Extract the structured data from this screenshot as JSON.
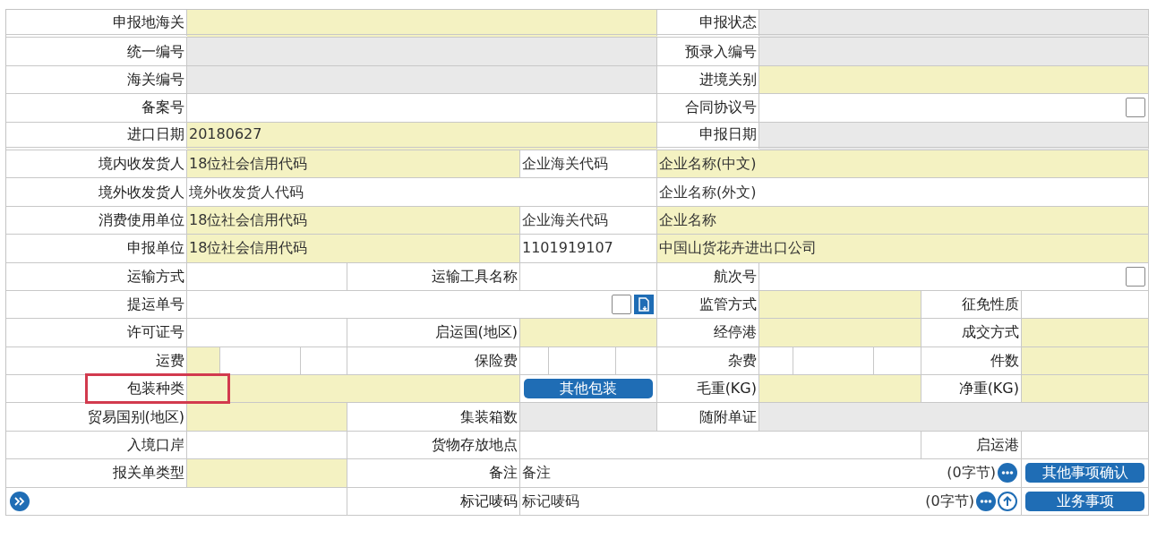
{
  "form": {
    "rows": [
      {
        "cells": [
          {
            "kind": "label",
            "text": "申报地海关"
          },
          {
            "kind": "field",
            "required": true,
            "readonly": false
          },
          {
            "kind": "label",
            "text": "申报状态"
          },
          {
            "kind": "field",
            "readonly": true
          }
        ]
      },
      {
        "cells": [
          {
            "kind": "label",
            "text": "统一编号"
          },
          {
            "kind": "field",
            "readonly": true
          },
          {
            "kind": "label",
            "text": "预录入编号"
          },
          {
            "kind": "field",
            "readonly": true
          }
        ]
      },
      {
        "cells": [
          {
            "kind": "label",
            "text": "海关编号"
          },
          {
            "kind": "field",
            "readonly": true
          },
          {
            "kind": "label",
            "text": "进境关别"
          },
          {
            "kind": "field",
            "required": true,
            "readonly": false
          }
        ]
      },
      {
        "cells": [
          {
            "kind": "label",
            "text": "备案号"
          },
          {
            "kind": "field",
            "required": false,
            "readonly": false
          },
          {
            "kind": "label",
            "text": "合同协议号"
          },
          {
            "kind": "field",
            "required": false,
            "readonly": false,
            "checkbox": {
              "checked": false
            }
          }
        ]
      },
      {
        "cells": [
          {
            "kind": "label",
            "text": "进口日期"
          },
          {
            "kind": "field",
            "required": true,
            "readonly": false,
            "value": "20180627"
          },
          {
            "kind": "label",
            "text": "申报日期"
          },
          {
            "kind": "field",
            "readonly": true
          }
        ]
      },
      {
        "cells": [
          {
            "kind": "label",
            "text": "境内收发货人"
          },
          {
            "kind": "field",
            "required": true,
            "readonly": false,
            "value": "18位社会信用代码"
          },
          {
            "kind": "field",
            "required": false,
            "readonly": false,
            "value": "企业海关代码"
          },
          {
            "kind": "field",
            "required": true,
            "readonly": false,
            "value": "企业名称(中文)"
          }
        ]
      },
      {
        "cells": [
          {
            "kind": "label",
            "text": "境外收发货人"
          },
          {
            "kind": "field",
            "required": false,
            "readonly": false,
            "value": "境外收发货人代码"
          },
          {
            "kind": "field",
            "required": false,
            "readonly": false,
            "value": "企业名称(外文)"
          }
        ]
      },
      {
        "cells": [
          {
            "kind": "label",
            "text": "消费使用单位"
          },
          {
            "kind": "field",
            "required": true,
            "readonly": false,
            "value": "18位社会信用代码"
          },
          {
            "kind": "field",
            "required": false,
            "readonly": false,
            "value": "企业海关代码"
          },
          {
            "kind": "field",
            "required": true,
            "readonly": false,
            "value": "企业名称"
          }
        ]
      },
      {
        "cells": [
          {
            "kind": "label",
            "text": "申报单位"
          },
          {
            "kind": "field",
            "required": true,
            "readonly": false,
            "value": "18位社会信用代码"
          },
          {
            "kind": "field",
            "required": false,
            "readonly": false,
            "value": "1101919107"
          },
          {
            "kind": "field",
            "required": true,
            "readonly": false,
            "value": "中国山货花卉进出口公司"
          }
        ]
      },
      {
        "cells": [
          {
            "kind": "label",
            "text": "运输方式"
          },
          {
            "kind": "field",
            "required": false,
            "readonly": false
          },
          {
            "kind": "label",
            "text": "运输工具名称"
          },
          {
            "kind": "field",
            "required": false,
            "readonly": false
          },
          {
            "kind": "label",
            "text": "航次号"
          },
          {
            "kind": "field",
            "required": false,
            "readonly": false,
            "checkbox": {
              "checked": false
            }
          }
        ]
      },
      {
        "cells": [
          {
            "kind": "label",
            "text": "提运单号"
          },
          {
            "kind": "field",
            "required": false,
            "readonly": false,
            "checkbox": {
              "checked": false
            },
            "lookup": true
          },
          {
            "kind": "label",
            "text": "监管方式"
          },
          {
            "kind": "field",
            "required": true,
            "readonly": false
          },
          {
            "kind": "label",
            "text": "征免性质"
          },
          {
            "kind": "field",
            "required": false,
            "readonly": false
          }
        ]
      },
      {
        "cells": [
          {
            "kind": "label",
            "text": "许可证号"
          },
          {
            "kind": "field",
            "required": false,
            "readonly": false
          },
          {
            "kind": "label",
            "text": "启运国(地区)"
          },
          {
            "kind": "field",
            "required": true,
            "readonly": false
          },
          {
            "kind": "label",
            "text": "经停港"
          },
          {
            "kind": "field",
            "required": true,
            "readonly": false
          },
          {
            "kind": "label",
            "text": "成交方式"
          },
          {
            "kind": "field",
            "required": true,
            "readonly": false
          }
        ]
      },
      {
        "cells": [
          {
            "kind": "label",
            "text": "运费"
          },
          {
            "kind": "field",
            "required": true,
            "readonly": false
          },
          {
            "kind": "field",
            "required": false,
            "readonly": false
          },
          {
            "kind": "field",
            "required": false,
            "readonly": false
          },
          {
            "kind": "label",
            "text": "保险费"
          },
          {
            "kind": "field",
            "required": false,
            "readonly": false
          },
          {
            "kind": "field",
            "required": false,
            "readonly": false
          },
          {
            "kind": "field",
            "required": false,
            "readonly": false
          },
          {
            "kind": "label",
            "text": "杂费"
          },
          {
            "kind": "field",
            "required": false,
            "readonly": false
          },
          {
            "kind": "field",
            "required": false,
            "readonly": false
          },
          {
            "kind": "field",
            "required": false,
            "readonly": false
          },
          {
            "kind": "label",
            "text": "件数"
          },
          {
            "kind": "field",
            "required": true,
            "readonly": false
          }
        ]
      },
      {
        "cells": [
          {
            "kind": "label",
            "text": "包装种类",
            "highlighted": true
          },
          {
            "kind": "field",
            "required": true,
            "readonly": false
          },
          {
            "kind": "button",
            "text": "其他包装"
          },
          {
            "kind": "label",
            "text": "毛重(KG)"
          },
          {
            "kind": "field",
            "required": true,
            "readonly": false
          },
          {
            "kind": "label",
            "text": "净重(KG)"
          },
          {
            "kind": "field",
            "required": true,
            "readonly": false
          }
        ]
      },
      {
        "cells": [
          {
            "kind": "label",
            "text": "贸易国别(地区)"
          },
          {
            "kind": "field",
            "required": true,
            "readonly": false
          },
          {
            "kind": "label",
            "text": "集装箱数"
          },
          {
            "kind": "field",
            "readonly": true
          },
          {
            "kind": "label",
            "text": "随附单证"
          },
          {
            "kind": "field",
            "readonly": true
          }
        ]
      },
      {
        "cells": [
          {
            "kind": "label",
            "text": "入境口岸"
          },
          {
            "kind": "field",
            "required": false,
            "readonly": false
          },
          {
            "kind": "label",
            "text": "货物存放地点"
          },
          {
            "kind": "field",
            "required": false,
            "readonly": false
          },
          {
            "kind": "label",
            "text": "启运港"
          },
          {
            "kind": "field",
            "required": false,
            "readonly": false
          }
        ]
      },
      {
        "cells": [
          {
            "kind": "label",
            "text": "报关单类型"
          },
          {
            "kind": "field",
            "required": true,
            "readonly": false
          },
          {
            "kind": "label",
            "text": "备注"
          },
          {
            "kind": "memo",
            "value": "备注",
            "counter": "(0字节)",
            "upload": false
          },
          {
            "kind": "button",
            "text": "其他事项确认"
          }
        ]
      },
      {
        "cells": [
          {
            "kind": "expand"
          },
          {
            "kind": "label",
            "text": "标记唛码"
          },
          {
            "kind": "memo",
            "value": "标记唛码",
            "counter": "(0字节)",
            "upload": true
          },
          {
            "kind": "button",
            "text": "业务事项"
          }
        ]
      }
    ]
  }
}
